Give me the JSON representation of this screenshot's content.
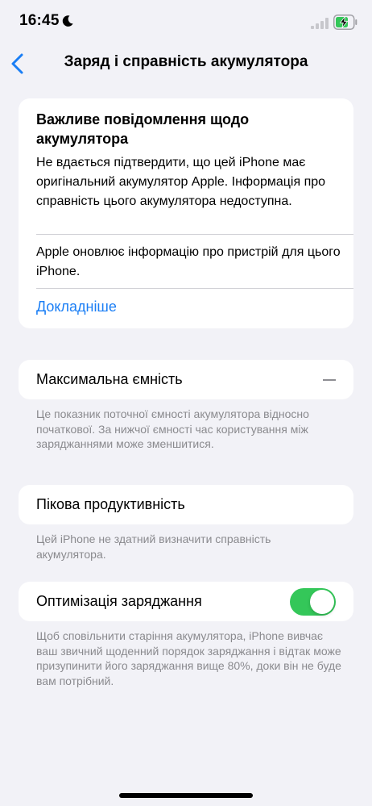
{
  "status_bar": {
    "time": "16:45",
    "icons": [
      "moon-icon",
      "signal-icon",
      "battery-charging-icon"
    ]
  },
  "nav": {
    "title": "Заряд і справність акумулятора",
    "back_icon": "chevron-left-icon"
  },
  "notice": {
    "title": "Важливе повідомлення щодо акумулятора",
    "body": "Не вдається підтвердити, що цей iPhone має оригінальний акумулятор Apple. Інформація про справність цього акумулятора недоступна.",
    "update": "Apple оновлює інформацію про пристрій для цього iPhone.",
    "link": "Докладніше"
  },
  "capacity": {
    "label": "Максимальна ємність",
    "value": "—",
    "footnote": "Це показник поточної ємності акумулятора відносно початкової. За нижчої ємності час користування між заряджаннями може зменшитися."
  },
  "peak": {
    "label": "Пікова продуктивність",
    "footnote": "Цей iPhone не здатний визначити справність акумулятора."
  },
  "optimization": {
    "label": "Оптимізація заряджання",
    "enabled": true,
    "footnote": "Щоб сповільнити старіння акумулятора, iPhone вивчає ваш звичний щоденний порядок заряджання і відтак може призупинити його заряджання вище 80%, доки він не буде вам потрібний."
  },
  "colors": {
    "accent": "#1a7ef5",
    "toggle_on": "#34c759",
    "background": "#f2f2f7",
    "secondary_text": "#8a8a8e",
    "battery_fill": "#34c759"
  }
}
